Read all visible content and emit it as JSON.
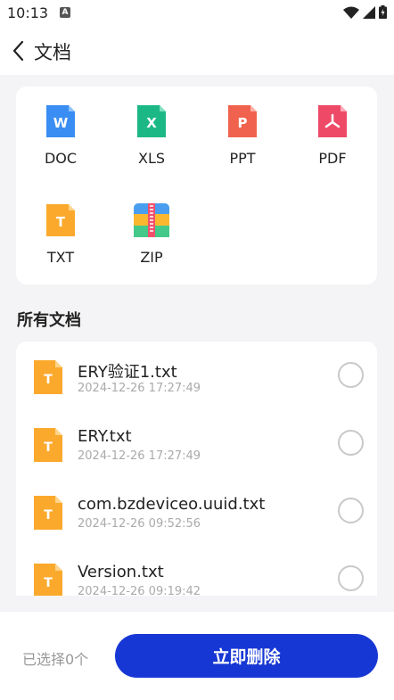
{
  "status_bar": {
    "time": "10:13",
    "notif_letter": "A"
  },
  "header": {
    "back_icon": "chevron-left-icon",
    "title": "文档"
  },
  "file_types": [
    {
      "label": "DOC",
      "icon": "word-doc-icon",
      "color": "#3a8df2",
      "glyph": "W"
    },
    {
      "label": "XLS",
      "icon": "excel-xls-icon",
      "color": "#1bb886",
      "glyph": "X"
    },
    {
      "label": "PPT",
      "icon": "powerpoint-ppt-icon",
      "color": "#f0624d",
      "glyph": "P"
    },
    {
      "label": "PDF",
      "icon": "pdf-icon",
      "color": "#ee4a68",
      "glyph": "A"
    },
    {
      "label": "TXT",
      "icon": "txt-icon",
      "color": "#fba92c",
      "glyph": "T"
    },
    {
      "label": "ZIP",
      "icon": "zip-archive-icon",
      "color": "#4a9ef0",
      "glyph": ""
    }
  ],
  "section_title": "所有文档",
  "files": [
    {
      "name": "ERY验证1.txt",
      "date": "2024-12-26 17:27:49",
      "selected": false
    },
    {
      "name": "ERY.txt",
      "date": "2024-12-26 17:27:49",
      "selected": false
    },
    {
      "name": "com.bzdeviceo.uuid.txt",
      "date": "2024-12-26 09:52:56",
      "selected": false
    },
    {
      "name": "Version.txt",
      "date": "2024-12-26 09:19:42",
      "selected": false
    }
  ],
  "bottom_bar": {
    "selected_label": "已选择0个",
    "delete_label": "立即删除"
  },
  "colors": {
    "accent": "#1737d4",
    "background": "#f4f4f6",
    "card": "#ffffff",
    "txt_icon": "#fba92c"
  }
}
